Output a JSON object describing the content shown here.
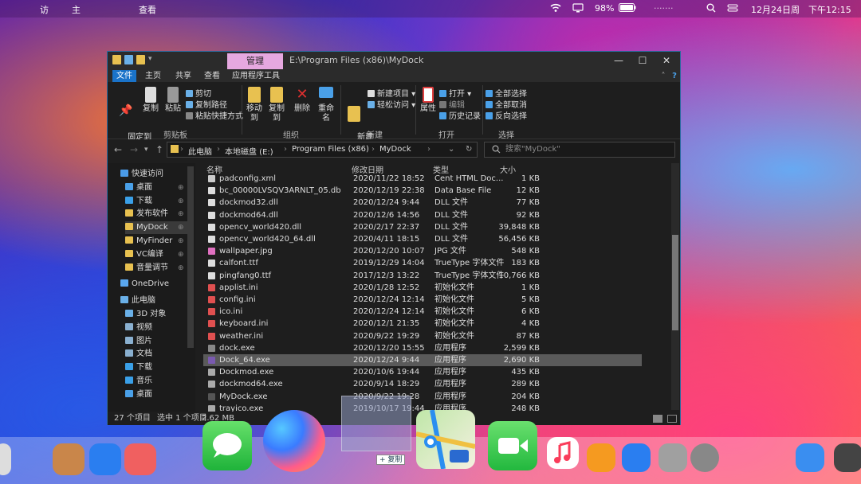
{
  "menubar": {
    "apple": "",
    "item1": "访",
    "item2": "主",
    "item3": "查看",
    "battery": "98%",
    "date": "12月24日",
    "weekday": "周",
    "time": "下午12:15"
  },
  "window": {
    "context_tab": "管理",
    "title_path": "E:\\Program Files (x86)\\MyDock",
    "minimize": "—",
    "maximize": "☐",
    "close": "✕"
  },
  "tabs": [
    "文件",
    "主页",
    "共享",
    "查看",
    "应用程序工具"
  ],
  "ribbon": {
    "pin": "固定到\n快速访问",
    "copy": "复制",
    "paste": "粘贴",
    "cut": "剪切",
    "copy_path": "复制路径",
    "paste_shortcut": "粘贴快捷方式",
    "move_to": "移动到",
    "copy_to": "复制到",
    "delete": "删除",
    "rename": "重命名",
    "new_folder": "新建\n文件夹",
    "new_item": "新建项目",
    "easy_access": "轻松访问",
    "properties": "属性",
    "open": "打开",
    "edit": "编辑",
    "history": "历史记录",
    "select_all": "全部选择",
    "select_none": "全部取消",
    "invert": "反向选择",
    "g_clipboard": "剪贴板",
    "g_organize": "组织",
    "g_new": "新建",
    "g_open": "打开",
    "g_select": "选择"
  },
  "address": {
    "crumbs": [
      "此电脑",
      "本地磁盘 (E:)",
      "Program Files (x86)",
      "MyDock"
    ],
    "search_placeholder": "搜索\"MyDock\""
  },
  "nav": [
    {
      "label": "快速访问",
      "color": "#4a9be8",
      "pinned": false,
      "indent": 0
    },
    {
      "label": "桌面",
      "color": "#4aa0e8",
      "pinned": true,
      "indent": 1
    },
    {
      "label": "下载",
      "color": "#3aa0e8",
      "pinned": true,
      "indent": 1
    },
    {
      "label": "发布软件",
      "color": "#e8c150",
      "pinned": true,
      "indent": 1
    },
    {
      "label": "MyDock",
      "color": "#e8c150",
      "pinned": true,
      "indent": 1,
      "selected": true
    },
    {
      "label": "MyFinder",
      "color": "#e8c150",
      "pinned": true,
      "indent": 1
    },
    {
      "label": "VC编译",
      "color": "#e8c150",
      "pinned": true,
      "indent": 1
    },
    {
      "label": "音量调节",
      "color": "#e8c150",
      "pinned": true,
      "indent": 1
    },
    {
      "label": "OneDrive",
      "color": "#5aa8f0",
      "pinned": false,
      "indent": 0
    },
    {
      "label": "此电脑",
      "color": "#6ab0e8",
      "pinned": false,
      "indent": 0
    },
    {
      "label": "3D 对象",
      "color": "#6ab0e8",
      "pinned": false,
      "indent": 1
    },
    {
      "label": "视频",
      "color": "#8ab0d0",
      "pinned": false,
      "indent": 1
    },
    {
      "label": "图片",
      "color": "#8ab0d0",
      "pinned": false,
      "indent": 1
    },
    {
      "label": "文档",
      "color": "#8ab0d0",
      "pinned": false,
      "indent": 1
    },
    {
      "label": "下载",
      "color": "#3aa0e8",
      "pinned": false,
      "indent": 1
    },
    {
      "label": "音乐",
      "color": "#3aa0e8",
      "pinned": false,
      "indent": 1
    },
    {
      "label": "桌面",
      "color": "#4aa0e8",
      "pinned": false,
      "indent": 1
    }
  ],
  "columns": {
    "name": "名称",
    "date": "修改日期",
    "type": "类型",
    "size": "大小"
  },
  "files": [
    {
      "name": "padconfig.xml",
      "date": "2020/11/22 18:52",
      "type": "Cent HTML Doc...",
      "size": "1 KB",
      "color": "#ccc"
    },
    {
      "name": "bc_00000LVSQV3ARNLT_05.db",
      "date": "2020/12/19 22:38",
      "type": "Data Base File",
      "size": "12 KB",
      "color": "#ddd"
    },
    {
      "name": "dockmod32.dll",
      "date": "2020/12/24 9:44",
      "type": "DLL 文件",
      "size": "77 KB",
      "color": "#ddd"
    },
    {
      "name": "dockmod64.dll",
      "date": "2020/12/6 14:56",
      "type": "DLL 文件",
      "size": "92 KB",
      "color": "#ddd"
    },
    {
      "name": "opencv_world420.dll",
      "date": "2020/2/17 22:37",
      "type": "DLL 文件",
      "size": "39,848 KB",
      "color": "#ddd"
    },
    {
      "name": "opencv_world420_64.dll",
      "date": "2020/4/11 18:15",
      "type": "DLL 文件",
      "size": "56,456 KB",
      "color": "#ddd"
    },
    {
      "name": "wallpaper.jpg",
      "date": "2020/12/20 10:07",
      "type": "JPG 文件",
      "size": "548 KB",
      "color": "#e070c0"
    },
    {
      "name": "calfont.ttf",
      "date": "2019/12/29 14:04",
      "type": "TrueType 字体文件",
      "size": "183 KB",
      "color": "#ddd"
    },
    {
      "name": "pingfang0.ttf",
      "date": "2017/12/3 13:22",
      "type": "TrueType 字体文件",
      "size": "10,766 KB",
      "color": "#ddd"
    },
    {
      "name": "applist.ini",
      "date": "2020/1/28 12:52",
      "type": "初始化文件",
      "size": "1 KB",
      "color": "#e05050"
    },
    {
      "name": "config.ini",
      "date": "2020/12/24 12:14",
      "type": "初始化文件",
      "size": "5 KB",
      "color": "#e05050"
    },
    {
      "name": "ico.ini",
      "date": "2020/12/24 12:14",
      "type": "初始化文件",
      "size": "6 KB",
      "color": "#e05050"
    },
    {
      "name": "keyboard.ini",
      "date": "2020/12/1 21:35",
      "type": "初始化文件",
      "size": "4 KB",
      "color": "#e05050"
    },
    {
      "name": "weather.ini",
      "date": "2020/9/22 19:29",
      "type": "初始化文件",
      "size": "87 KB",
      "color": "#e05050"
    },
    {
      "name": "dock.exe",
      "date": "2020/12/20 15:55",
      "type": "应用程序",
      "size": "2,599 KB",
      "color": "#888"
    },
    {
      "name": "Dock_64.exe",
      "date": "2020/12/24 9:44",
      "type": "应用程序",
      "size": "2,690 KB",
      "color": "#7a5ab0",
      "selected": true
    },
    {
      "name": "Dockmod.exe",
      "date": "2020/10/6 19:44",
      "type": "应用程序",
      "size": "435 KB",
      "color": "#aaa"
    },
    {
      "name": "dockmod64.exe",
      "date": "2020/9/14 18:29",
      "type": "应用程序",
      "size": "289 KB",
      "color": "#aaa"
    },
    {
      "name": "MyDock.exe",
      "date": "2020/9/22 19:28",
      "type": "应用程序",
      "size": "204 KB",
      "color": "#555"
    },
    {
      "name": "trayico.exe",
      "date": "2019/10/17 19:44",
      "type": "应用程序",
      "size": "248 KB",
      "color": "#aaa"
    }
  ],
  "status": {
    "count": "27 个项目",
    "selected": "选中 1 个项目",
    "size": "2.62 MB"
  },
  "drag": {
    "copy_label": "+ 复制"
  }
}
